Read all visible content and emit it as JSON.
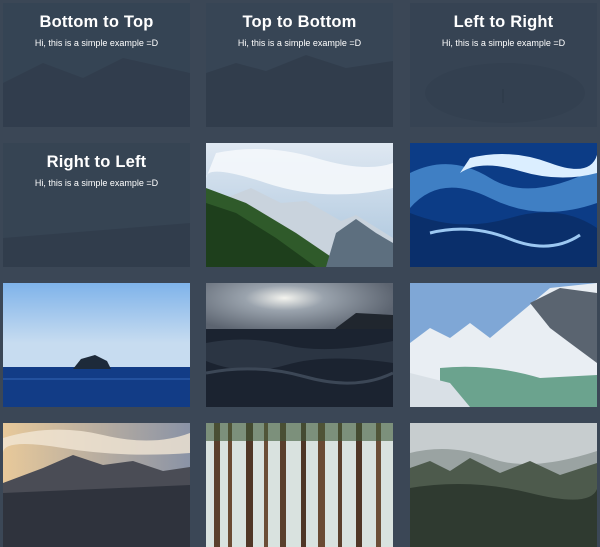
{
  "captions": [
    {
      "title": "Bottom to Top",
      "text": "Hi, this is a simple example =D"
    },
    {
      "title": "Top to Bottom",
      "text": "Hi, this is a simple example =D"
    },
    {
      "title": "Left to Right",
      "text": "Hi, this is a simple example =D"
    },
    {
      "title": "Right to Left",
      "text": "Hi, this is a simple example =D"
    }
  ],
  "images": [
    "forest-mountain-photo",
    "ocean-wave-photo",
    "island-sea-photo",
    "dark-sea-sunset-photo",
    "snowy-mountain-lake-photo",
    "mountain-sunset-photo",
    "pine-forest-photo",
    "misty-forest-photo"
  ]
}
